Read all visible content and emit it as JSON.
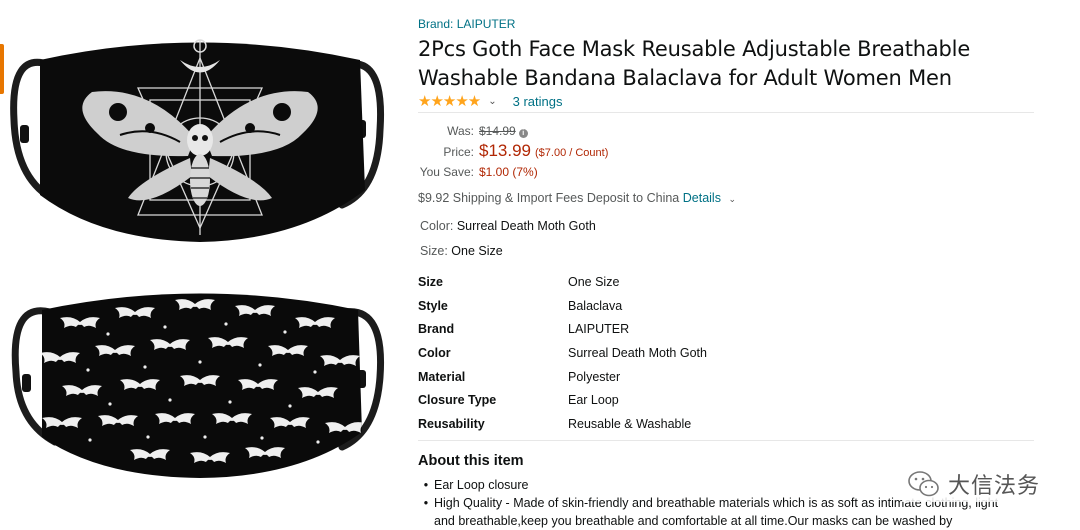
{
  "product": {
    "brand": "Brand: LAIPUTER",
    "title": "2Pcs Goth Face Mask Reusable Adjustable Breathable Washable Bandana Balaclava for Adult Women Men",
    "rating_stars": "★★★★★",
    "ratings_count": "3 ratings"
  },
  "price": {
    "was_label": "Was:",
    "was_value": "$14.99",
    "price_label": "Price:",
    "price_value": "$13.99",
    "per_count": "($7.00 / Count)",
    "save_label": "You Save:",
    "save_value": "$1.00 (7%)"
  },
  "shipping": {
    "text": "$9.92 Shipping & Import Fees Deposit to China",
    "details_label": "Details"
  },
  "selection": {
    "color_label": "Color:",
    "color_value": "Surreal Death Moth Goth",
    "size_label": "Size:",
    "size_value": "One Size"
  },
  "specs": [
    {
      "key": "Size",
      "value": "One Size"
    },
    {
      "key": "Style",
      "value": "Balaclava"
    },
    {
      "key": "Brand",
      "value": "LAIPUTER"
    },
    {
      "key": "Color",
      "value": "Surreal Death Moth Goth"
    },
    {
      "key": "Material",
      "value": "Polyester"
    },
    {
      "key": "Closure Type",
      "value": "Ear Loop"
    },
    {
      "key": "Reusability",
      "value": "Reusable & Washable"
    }
  ],
  "about": {
    "heading": "About this item",
    "bullets": [
      "Ear Loop closure",
      "High Quality - Made of skin-friendly and breathable materials which is as soft as intimate clothing, light and breathable,keep you breathable and comfortable at all time.Our masks can be washed by"
    ]
  },
  "watermark": {
    "text": "大信法务"
  },
  "icons": {
    "star": "star-icon",
    "chevron": "chevron-down-icon",
    "info": "info-icon",
    "wechat": "wechat-icon"
  },
  "colors": {
    "link": "#007185",
    "price": "#b12704",
    "star": "#ffa41c"
  }
}
